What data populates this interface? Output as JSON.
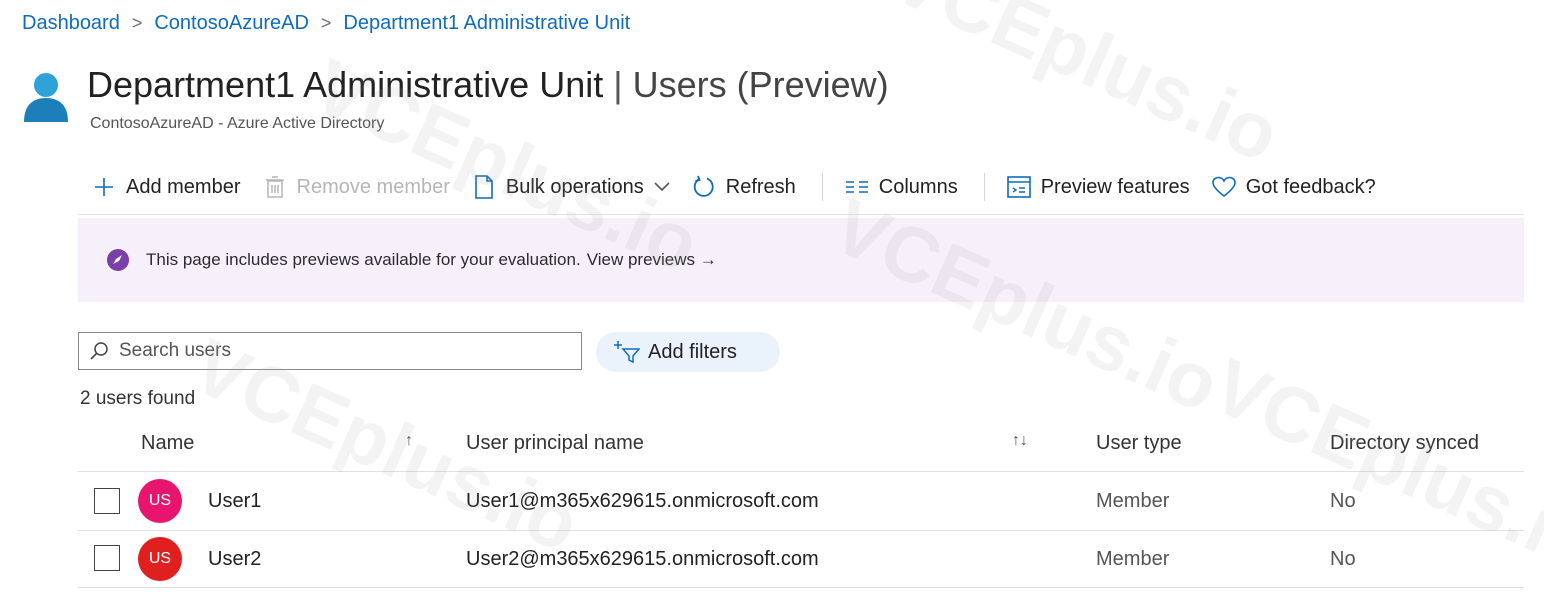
{
  "breadcrumb": {
    "items": [
      "Dashboard",
      "ContosoAzureAD",
      "Department1 Administrative Unit"
    ],
    "separator": ">"
  },
  "header": {
    "title": "Department1 Administrative Unit",
    "section": "Users (Preview)",
    "subtitle": "ContosoAzureAD - Azure Active Directory",
    "icon": "user-icon"
  },
  "toolbar": {
    "add_member": "Add member",
    "remove_member": "Remove member",
    "bulk_operations": "Bulk operations",
    "refresh": "Refresh",
    "columns": "Columns",
    "preview_features": "Preview features",
    "feedback": "Got feedback?"
  },
  "banner": {
    "text": "This page includes previews available for your evaluation.",
    "link": "View previews →"
  },
  "search": {
    "placeholder": "Search users"
  },
  "filters": {
    "label": "Add filters"
  },
  "results": {
    "count_text": "2 users found"
  },
  "table": {
    "headers": {
      "name": "Name",
      "name_sort": "↑",
      "upn": "User principal name",
      "upn_sort": "↑↓",
      "type": "User type",
      "synced": "Directory synced"
    },
    "rows": [
      {
        "initials": "US",
        "name": "User1",
        "upn": "User1@m365x629615.onmicrosoft.com",
        "type": "Member",
        "synced": "No",
        "avatar_color": "#e8156e"
      },
      {
        "initials": "US",
        "name": "User2",
        "upn": "User2@m365x629615.onmicrosoft.com",
        "type": "Member",
        "synced": "No",
        "avatar_color": "#e0201e"
      }
    ]
  },
  "colors": {
    "accent": "#0f6cbd",
    "banner_bg": "#f6f0fa",
    "banner_icon": "#7a3fa8"
  },
  "watermark": "VCEplus.io"
}
